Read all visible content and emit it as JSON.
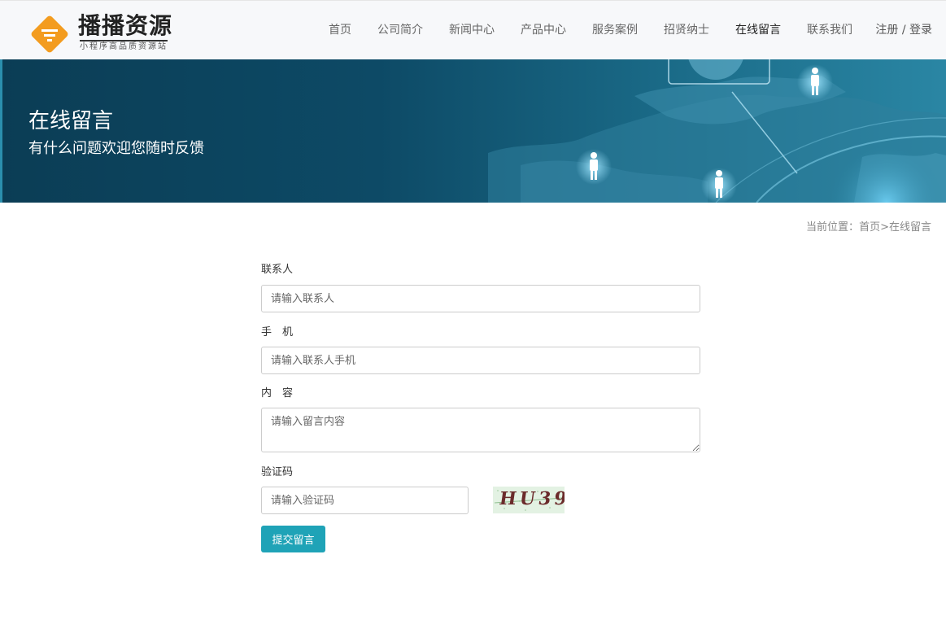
{
  "brand": {
    "title": "播播资源",
    "subtitle": "小程序高品质资源站",
    "color": "#f39c1f"
  },
  "nav": {
    "items": [
      {
        "label": "首页"
      },
      {
        "label": "公司简介"
      },
      {
        "label": "新闻中心"
      },
      {
        "label": "产品中心"
      },
      {
        "label": "服务案例"
      },
      {
        "label": "招贤纳士"
      },
      {
        "label": "在线留言",
        "active": true
      },
      {
        "label": "联系我们"
      }
    ],
    "register": "注册",
    "separator": " / ",
    "login": "登录"
  },
  "banner": {
    "title": "在线留言",
    "subtitle": "有什么问题欢迎您随时反馈"
  },
  "breadcrumb": {
    "prefix": "当前位置：",
    "home": "首页",
    "sep": ">",
    "current": "在线留言"
  },
  "form": {
    "contact_label": "联系人",
    "contact_placeholder": "请输入联系人",
    "phone_label": "手　机",
    "phone_placeholder": "请输入联系人手机",
    "content_label": "内　容",
    "content_placeholder": "请输入留言内容",
    "captcha_label": "验证码",
    "captcha_placeholder": "请输入验证码",
    "captcha_text": "HU39",
    "submit_label": "提交留言"
  },
  "colors": {
    "accent": "#1fa3b7",
    "banner": "#0d4a66"
  }
}
